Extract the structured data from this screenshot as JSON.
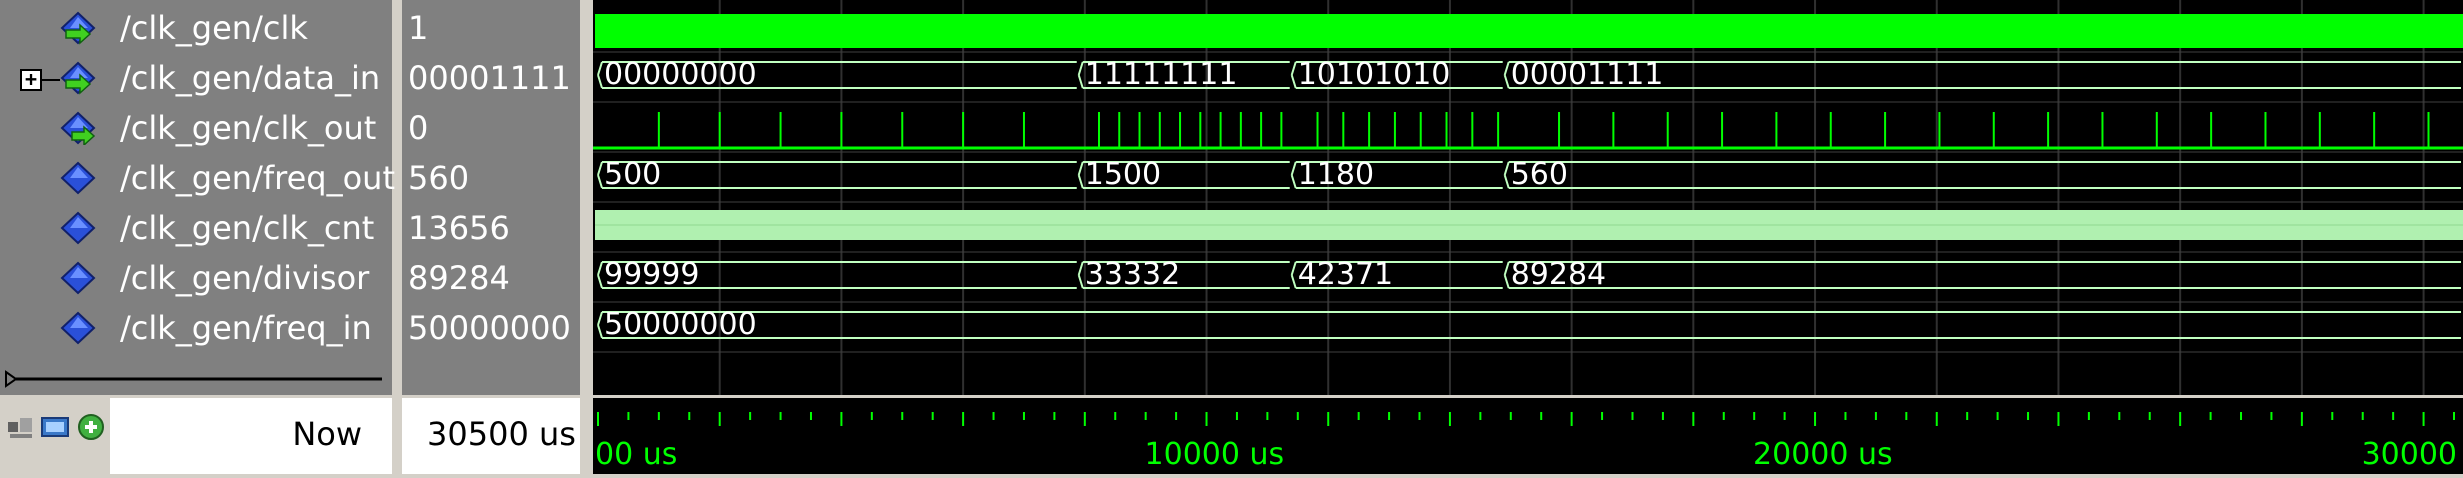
{
  "signals": [
    {
      "name": "/clk_gen/clk",
      "value": "1",
      "icon": "input-port-icon",
      "expandable": false
    },
    {
      "name": "/clk_gen/data_in",
      "value": "00001111",
      "icon": "input-port-icon",
      "expandable": true
    },
    {
      "name": "/clk_gen/clk_out",
      "value": "0",
      "icon": "output-port-icon",
      "expandable": false
    },
    {
      "name": "/clk_gen/freq_out",
      "value": "560",
      "icon": "signal-icon",
      "expandable": false
    },
    {
      "name": "/clk_gen/clk_cnt",
      "value": "13656",
      "icon": "signal-icon",
      "expandable": false
    },
    {
      "name": "/clk_gen/divisor",
      "value": "89284",
      "icon": "signal-icon",
      "expandable": false
    },
    {
      "name": "/clk_gen/freq_in",
      "value": "50000000",
      "icon": "signal-icon",
      "expandable": false
    }
  ],
  "status": {
    "now_label": "Now",
    "now_value": "30500 us"
  },
  "ruler": {
    "labels": [
      "00 us",
      "10000 us",
      "20000 us",
      "30000"
    ]
  },
  "waves": {
    "data_in": [
      "00000000",
      "11111111",
      "10101010",
      "00001111"
    ],
    "freq_out": [
      "500",
      "1500",
      "1180",
      "560"
    ],
    "divisor": [
      "99999",
      "33332",
      "42371",
      "89284"
    ],
    "freq_in": [
      "50000000"
    ]
  },
  "colors": {
    "wave": "#00ff00",
    "bus": "#c0ffc0",
    "clk_cnt": "#b0f0b0",
    "ruler": "#00ff00"
  }
}
